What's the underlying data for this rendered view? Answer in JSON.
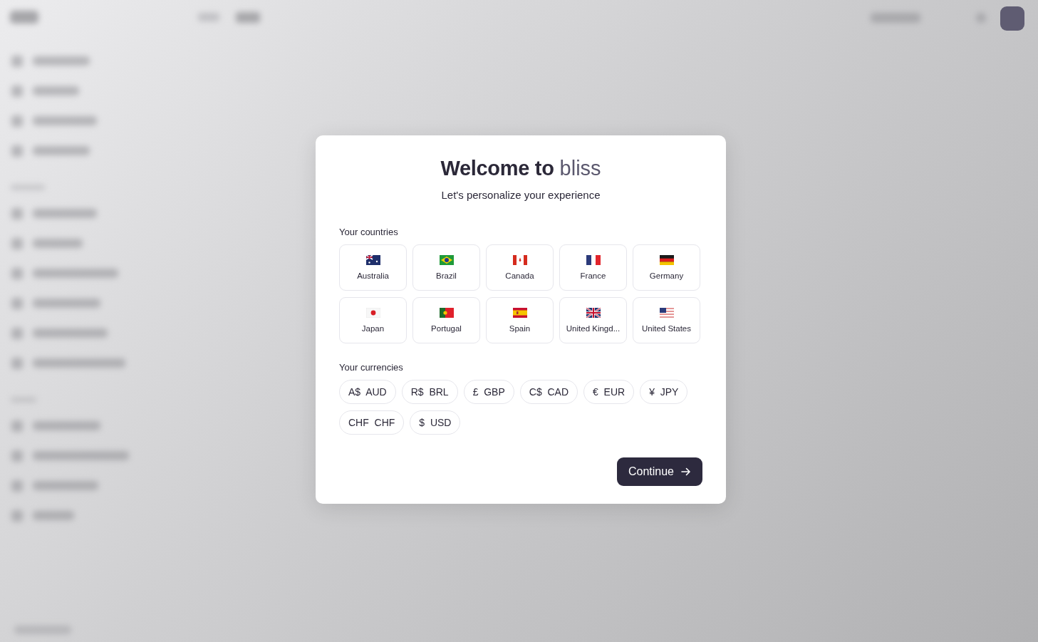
{
  "dialog": {
    "title": "Welcome to",
    "brand": "bliss",
    "subtitle": "Let's personalize your experience",
    "countries_label": "Your countries",
    "countries": [
      {
        "name": "Australia"
      },
      {
        "name": "Brazil"
      },
      {
        "name": "Canada"
      },
      {
        "name": "France"
      },
      {
        "name": "Germany"
      },
      {
        "name": "Japan"
      },
      {
        "name": "Portugal"
      },
      {
        "name": "Spain"
      },
      {
        "name": "United Kingd..."
      },
      {
        "name": "United States"
      }
    ],
    "currencies_label": "Your currencies",
    "currencies": [
      {
        "label": "A$  AUD"
      },
      {
        "label": "R$  BRL"
      },
      {
        "label": "£  GBP"
      },
      {
        "label": "C$  CAD"
      },
      {
        "label": "€  EUR"
      },
      {
        "label": "¥  JPY"
      },
      {
        "label": "CHF  CHF"
      },
      {
        "label": "$  USD"
      }
    ],
    "continue_button": "Continue"
  }
}
